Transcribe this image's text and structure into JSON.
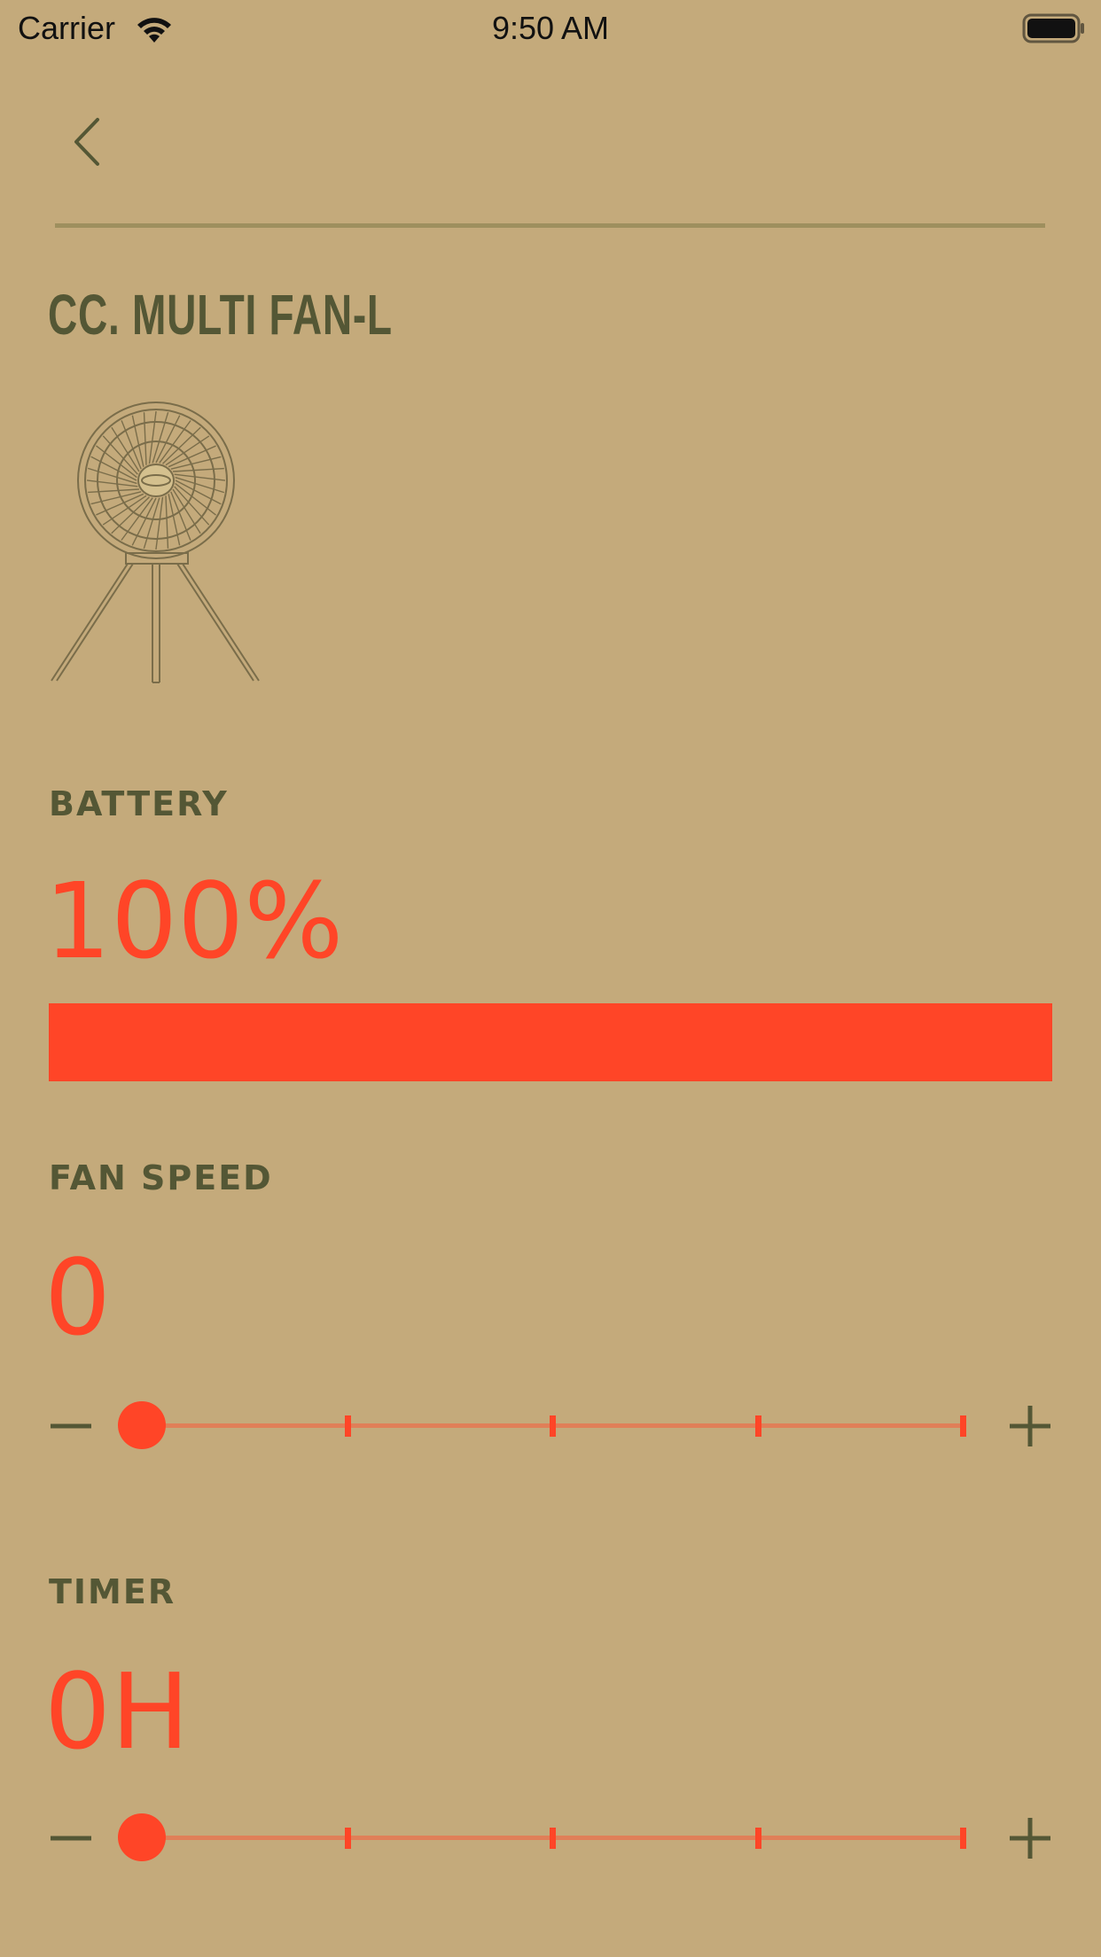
{
  "status_bar": {
    "carrier": "Carrier",
    "time": "9:50 AM"
  },
  "header": {
    "back_icon": "chevron-left-icon"
  },
  "device": {
    "title": "CC. MULTI FAN-L",
    "image_icon": "tripod-fan-illustration"
  },
  "battery": {
    "label": "BATTERY",
    "value_text": "100%",
    "level_percent": 100
  },
  "fan_speed": {
    "label": "FAN SPEED",
    "value_text": "0",
    "value": 0,
    "min": 0,
    "max": 4,
    "steps": 5,
    "minus_icon": "minus-icon",
    "plus_icon": "plus-icon"
  },
  "timer": {
    "label": "TIMER",
    "value_text": "0H",
    "value": 0,
    "min": 0,
    "max": 4,
    "steps": 5,
    "minus_icon": "minus-icon",
    "plus_icon": "plus-icon"
  },
  "colors": {
    "background": "#c4aa7b",
    "accent": "#ff4527",
    "label": "#545735",
    "track": "#e07f58",
    "divider": "#9e8f5e"
  }
}
